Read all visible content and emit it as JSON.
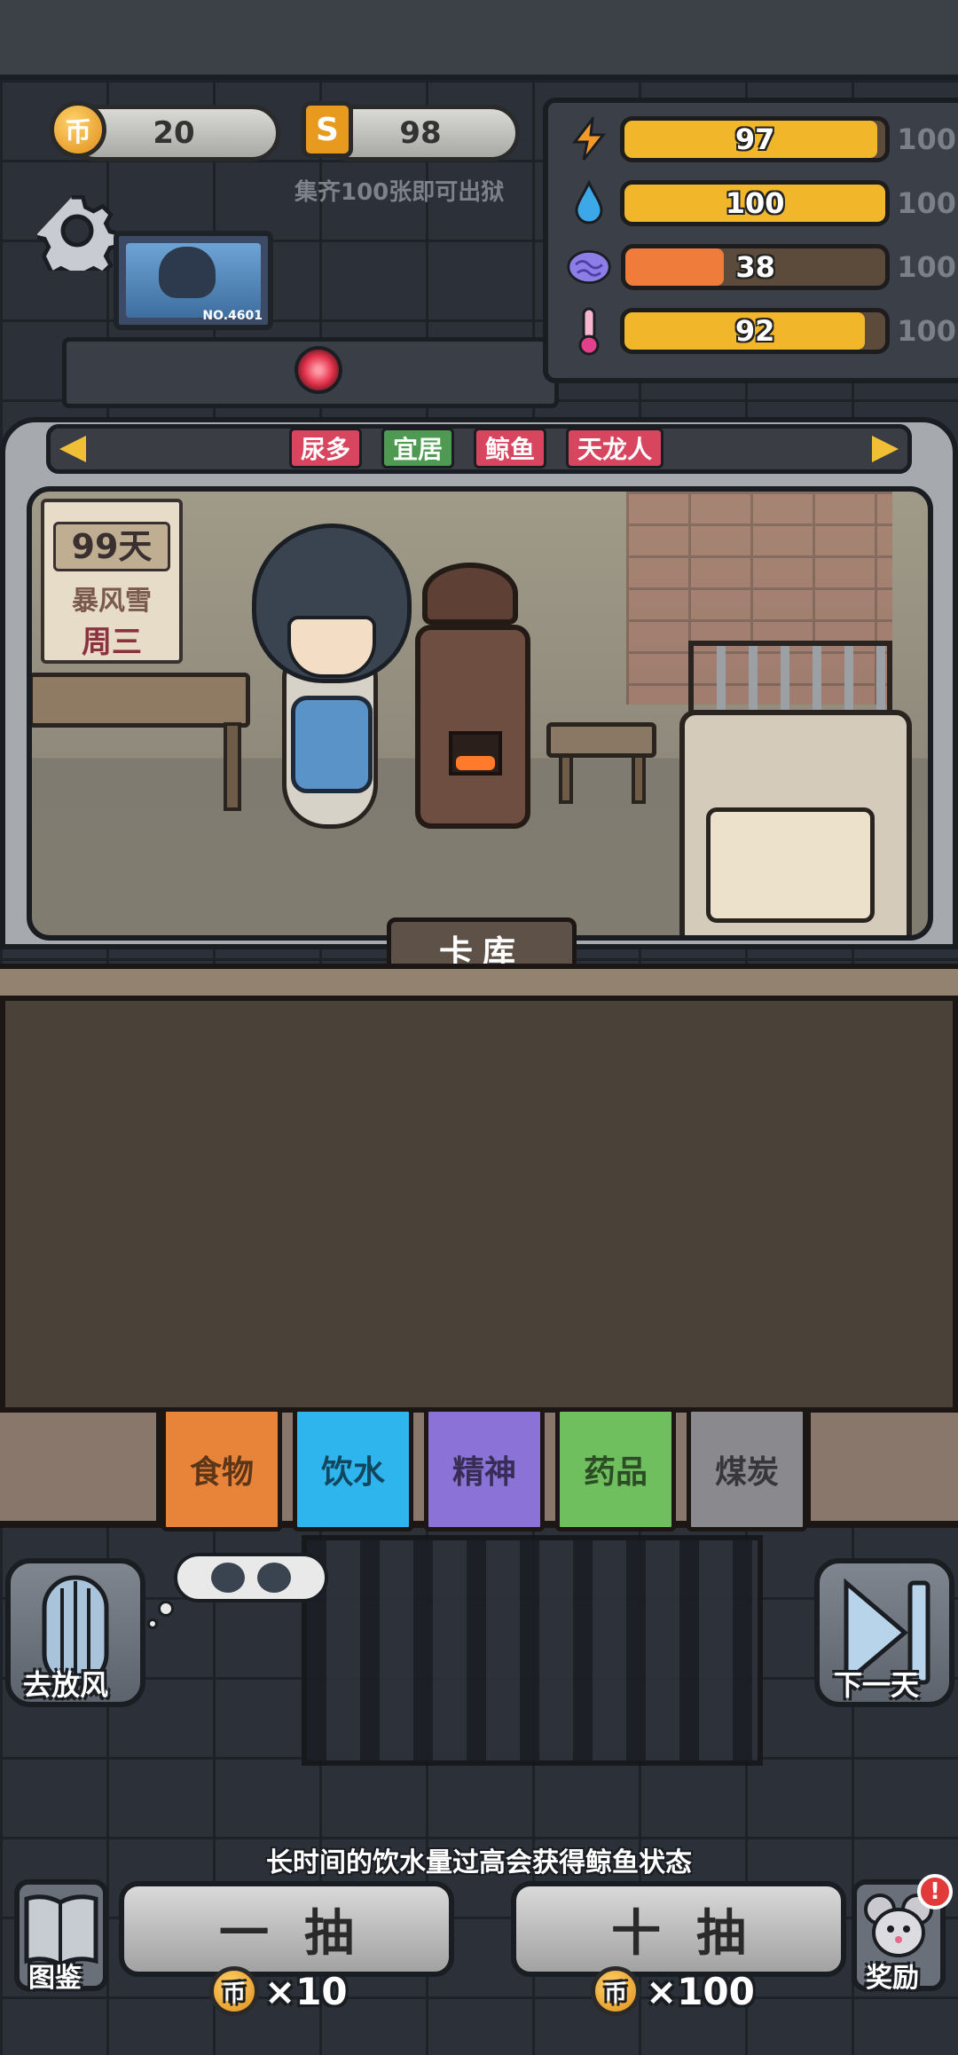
{
  "currency": {
    "coin_icon": "币",
    "coins": "20",
    "shard_icon": "S",
    "shards": "98",
    "collect_hint": "集齐100张即可出狱"
  },
  "stats": [
    {
      "name": "energy",
      "icon": "lightning-icon",
      "value": "97",
      "max": "100",
      "fill": 0.97,
      "color": "#f1b62a"
    },
    {
      "name": "water",
      "icon": "water-drop-icon",
      "value": "100",
      "max": "100",
      "fill": 1.0,
      "color": "#f1b62a"
    },
    {
      "name": "mind",
      "icon": "brain-icon",
      "value": "38",
      "max": "100",
      "fill": 0.38,
      "color": "#ef7c3a"
    },
    {
      "name": "temperature",
      "icon": "thermometer-icon",
      "value": "92",
      "max": "100",
      "fill": 0.92,
      "color": "#f1b62a"
    }
  ],
  "monitor": {
    "id": "NO.4601"
  },
  "tags": [
    {
      "label": "尿多",
      "color": "#d8455e"
    },
    {
      "label": "宜居",
      "color": "#4f9a52"
    },
    {
      "label": "鲸鱼",
      "color": "#d8455e"
    },
    {
      "label": "天龙人",
      "color": "#d8455e"
    }
  ],
  "calendar": {
    "days": "99天",
    "weather": "暴风雪",
    "weekday": "周三"
  },
  "deck_title": "卡库",
  "categories": [
    {
      "label": "食物",
      "color": "#e8843a"
    },
    {
      "label": "饮水",
      "color": "#2fb5ee"
    },
    {
      "label": "精神",
      "color": "#8a72d6"
    },
    {
      "label": "药品",
      "color": "#6fbf5e"
    },
    {
      "label": "煤炭",
      "color": "#8a8a8e"
    }
  ],
  "actions": {
    "yard": "去放风",
    "next_day": "下一天",
    "codex": "图鉴",
    "reward": "奖励",
    "reward_badge": "!"
  },
  "tip": "长时间的饮水量过高会获得鲸鱼状态",
  "draw": {
    "single_label": "一抽",
    "single_cost": "×10",
    "ten_label": "十抽",
    "ten_cost": "×100"
  }
}
